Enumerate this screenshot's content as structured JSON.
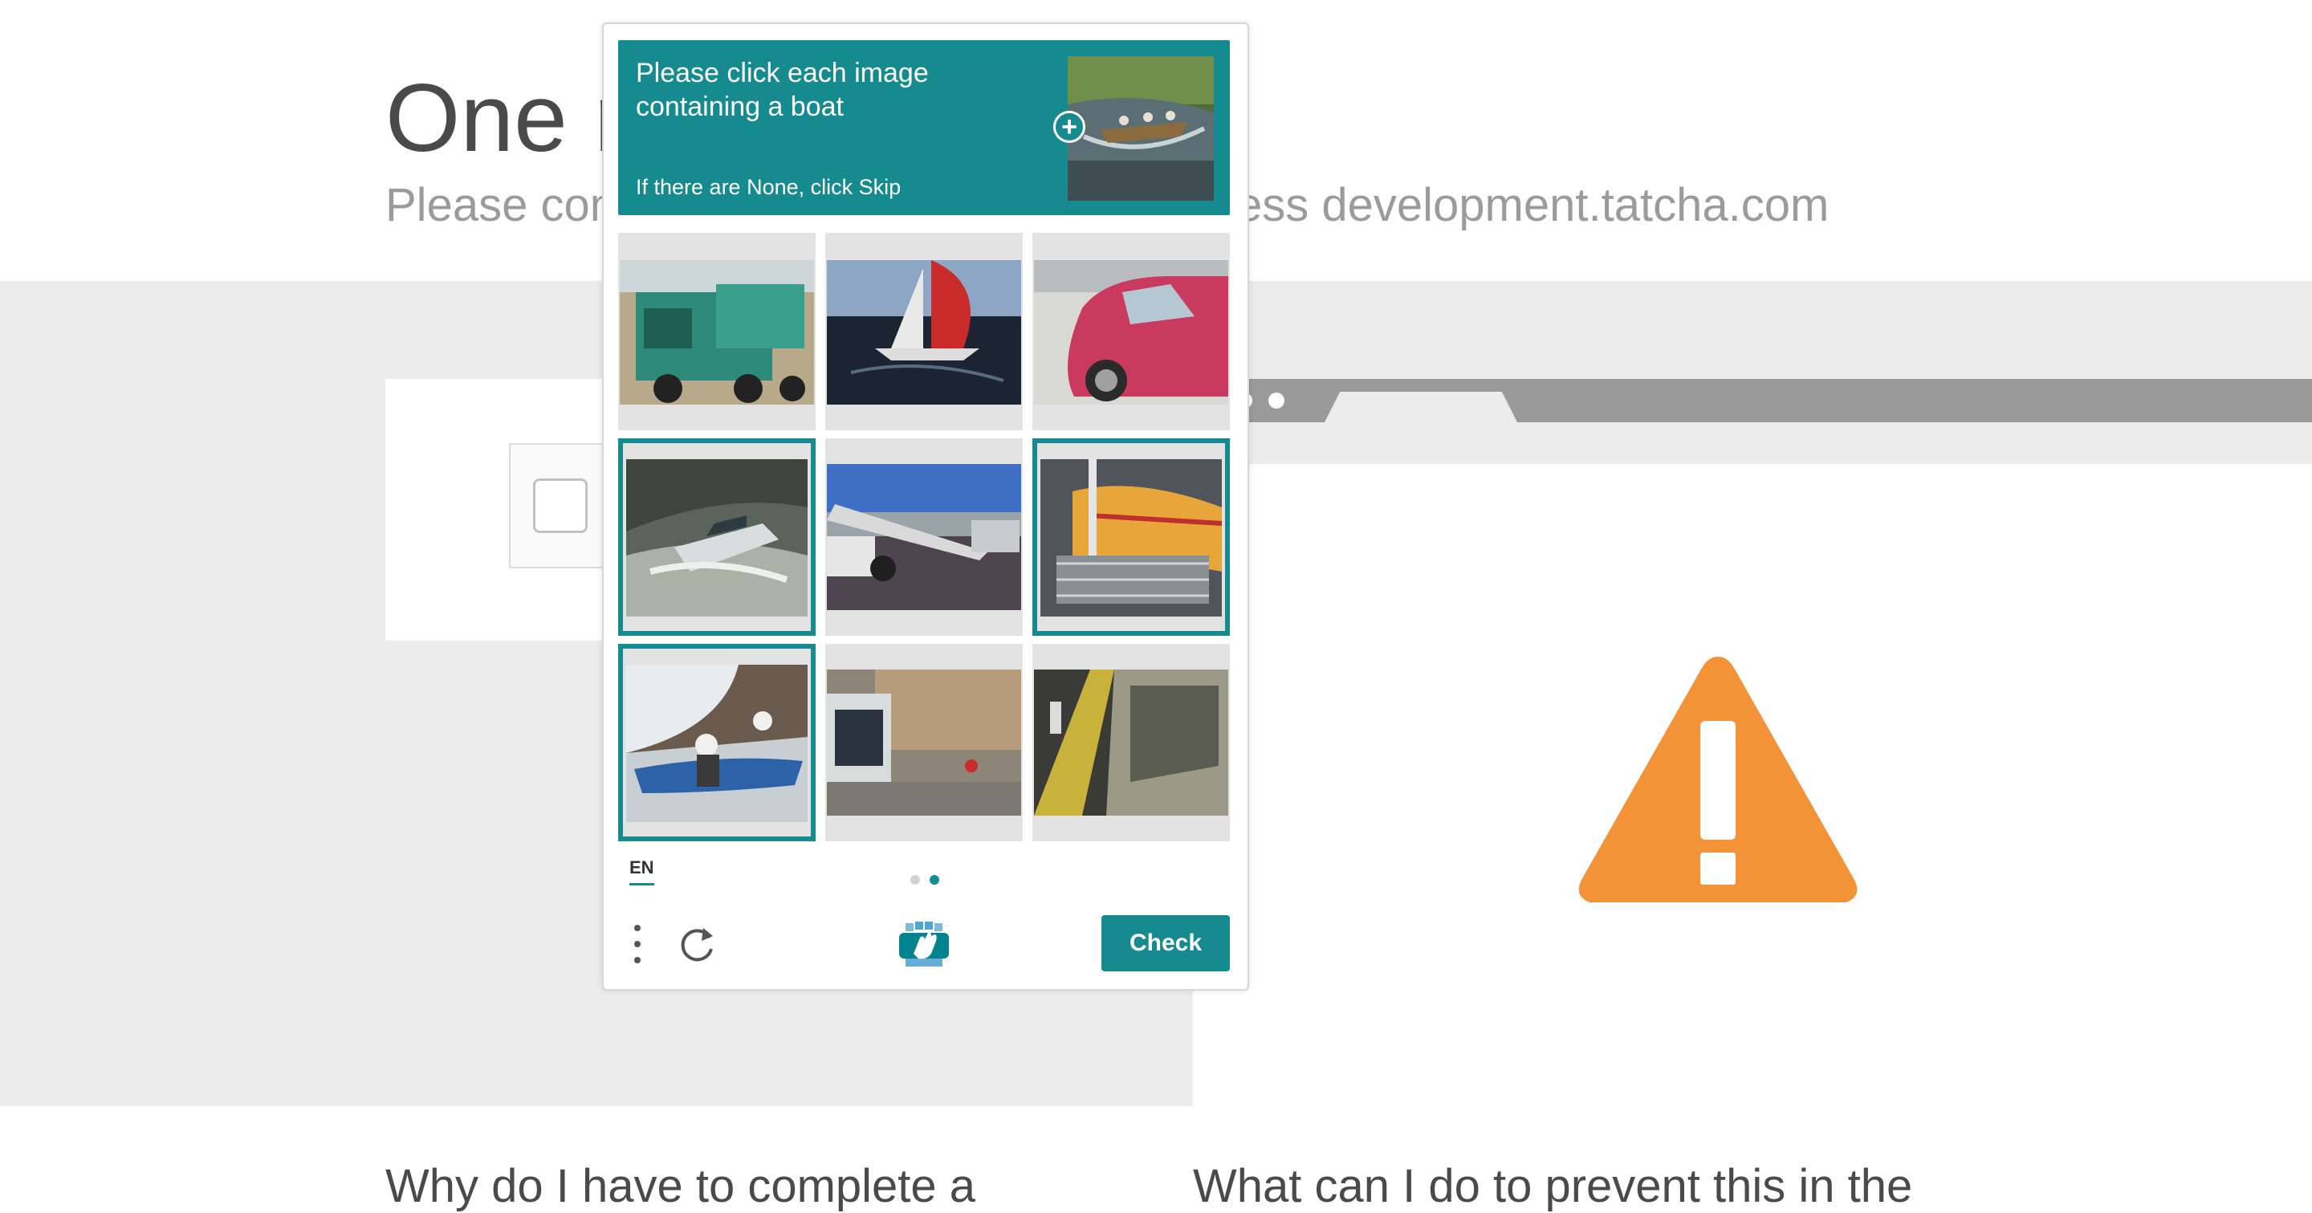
{
  "page": {
    "title_fragment": "One r",
    "subtitle_left": "Please com",
    "subtitle_right": "ess development.tatcha.com",
    "bottom_left_heading": "Why do I have to complete a",
    "bottom_right_heading": "What can I do to prevent this in the"
  },
  "captcha": {
    "prompt": "Please click each image containing a boat",
    "hint": "If there are None, click Skip",
    "zoom_icon": "plus-circle-icon",
    "language": "EN",
    "page_indicator": {
      "total": 2,
      "current": 2
    },
    "check_label": "Check",
    "menu_icon": "more-vertical-icon",
    "refresh_icon": "refresh-icon",
    "logo_icon": "hcaptcha-logo-icon",
    "accent_color": "#158a8f",
    "tiles": [
      {
        "subject": "truck",
        "selected": false
      },
      {
        "subject": "sailboat",
        "selected": false
      },
      {
        "subject": "car",
        "selected": false
      },
      {
        "subject": "speedboat",
        "selected": true
      },
      {
        "subject": "tow-truck",
        "selected": false
      },
      {
        "subject": "boat-deck",
        "selected": true
      },
      {
        "subject": "kayak",
        "selected": true
      },
      {
        "subject": "bus",
        "selected": false
      },
      {
        "subject": "train",
        "selected": false
      }
    ]
  },
  "warning": {
    "icon": "warning-triangle-icon",
    "color": "#f39237"
  }
}
